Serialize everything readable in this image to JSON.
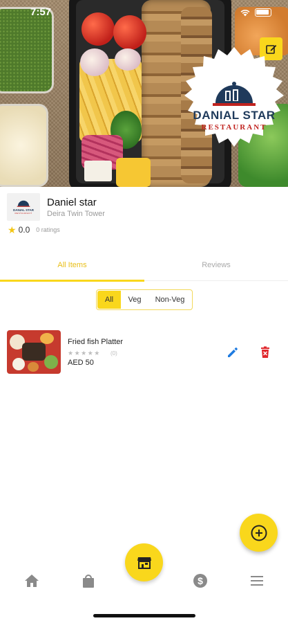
{
  "status_bar": {
    "time": "7:57"
  },
  "hero": {
    "logo_name": "DANIAL STAR",
    "logo_sub": "RESTAURANT",
    "edit_cover_icon": "edit-icon"
  },
  "restaurant": {
    "name": "Daniel star",
    "location": "Deira Twin Tower",
    "rating": "0.0",
    "rating_count": "0 ratings"
  },
  "tabs": [
    {
      "label": "All Items",
      "active": true
    },
    {
      "label": "Reviews",
      "active": false
    }
  ],
  "filters": [
    {
      "label": "All",
      "active": true
    },
    {
      "label": "Veg",
      "active": false
    },
    {
      "label": "Non-Veg",
      "active": false
    }
  ],
  "items": [
    {
      "name": "Fried fish Platter",
      "stars": "★★★★★",
      "rating_value": 0,
      "reviews": "(0)",
      "price": "AED 50"
    }
  ],
  "nav": {
    "items": [
      "home-icon",
      "shopping-bag-icon",
      "store-icon",
      "dollar-icon",
      "menu-icon"
    ]
  },
  "colors": {
    "accent": "#f9d71c",
    "edit_blue": "#1e7be0",
    "delete_red": "#e0262b",
    "logo_navy": "#1f3a5b",
    "logo_red": "#c0231f"
  }
}
